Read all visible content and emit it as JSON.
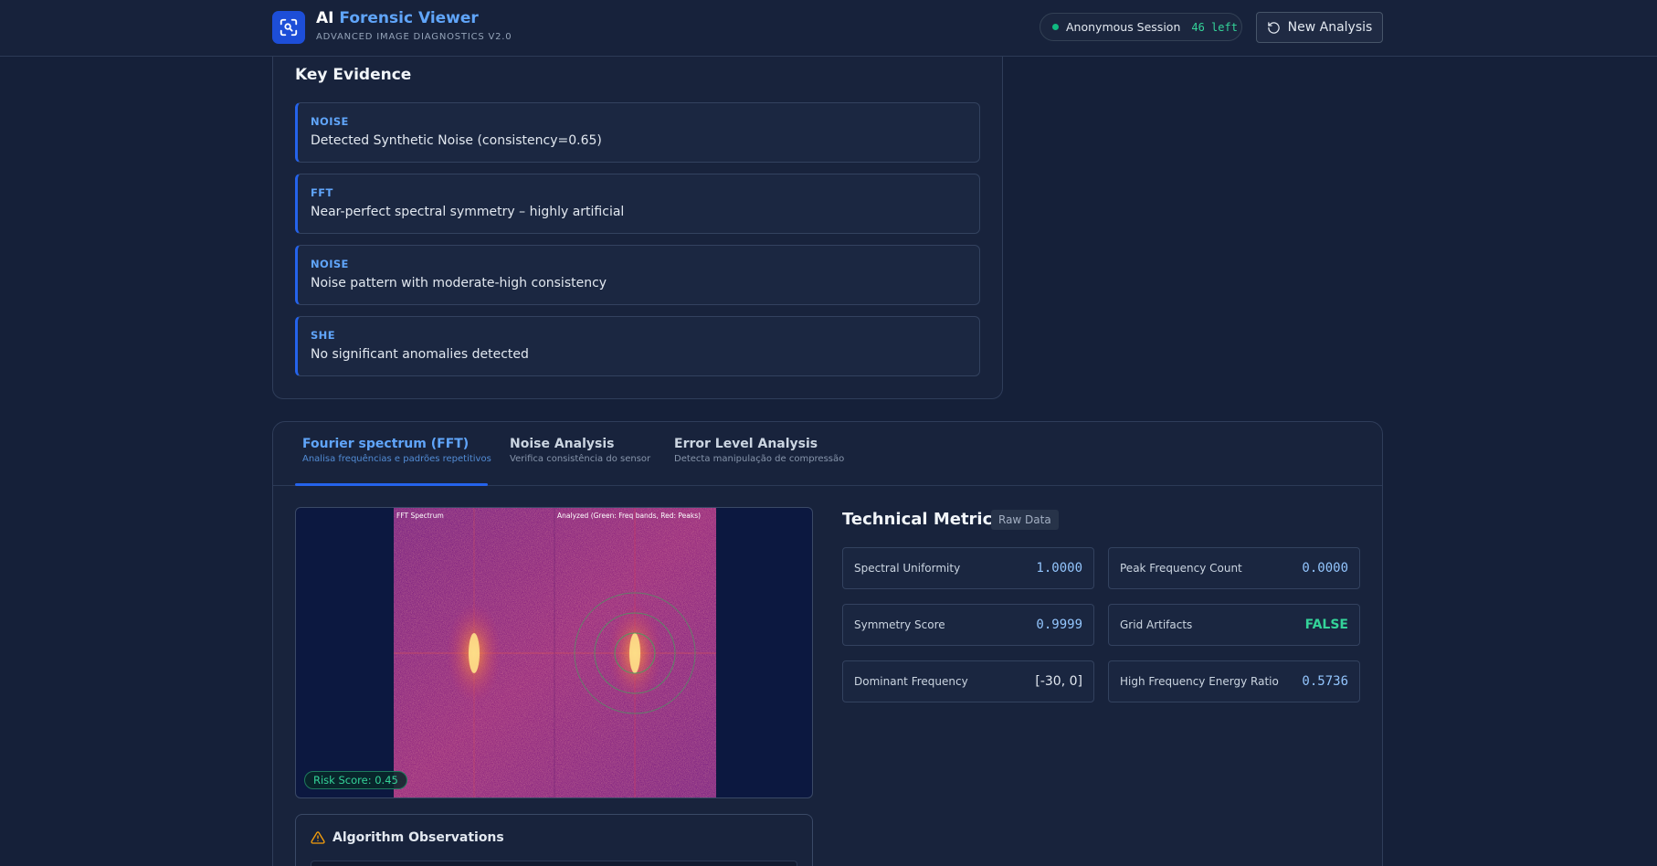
{
  "header": {
    "brand_prefix": "AI",
    "brand_name": "Forensic Viewer",
    "subtitle": "ADVANCED IMAGE DIAGNOSTICS V2.0",
    "session_label": "Anonymous Session",
    "session_left": "46 left",
    "new_analysis_label": "New Analysis",
    "colors": {
      "accent": "#60a5fa",
      "logo_bg": "#1d4ed8",
      "online": "#10b981"
    }
  },
  "evidence": {
    "title": "Key Evidence",
    "items": [
      {
        "tag": "NOISE",
        "text": "Detected Synthetic Noise (consistency=0.65)"
      },
      {
        "tag": "FFT",
        "text": "Near-perfect spectral symmetry – highly artificial"
      },
      {
        "tag": "NOISE",
        "text": "Noise pattern with moderate-high consistency"
      },
      {
        "tag": "SHE",
        "text": "No significant anomalies detected"
      }
    ]
  },
  "tabs": [
    {
      "label": "Fourier spectrum (FFT)",
      "sub": "Analisa frequências e padrões repetitivos",
      "active": true
    },
    {
      "label": "Noise Analysis",
      "sub": "Verifica consistência do sensor",
      "active": false
    },
    {
      "label": "Error Level Analysis",
      "sub": "Detecta manipulação de compressão",
      "active": false
    }
  ],
  "viewer": {
    "left_label": "FFT Spectrum",
    "right_label": "Analyzed (Green: Freq bands, Red: Peaks)",
    "risk_score": "Risk Score: 0.45"
  },
  "observations": {
    "title": "Algorithm Observations",
    "icon": "warning-triangle-icon"
  },
  "metrics": {
    "title": "Technical Metrics",
    "badge": "Raw Data",
    "items": [
      {
        "label": "Spectral Uniformity",
        "value": "1.0000"
      },
      {
        "label": "Peak Frequency Count",
        "value": "0.0000"
      },
      {
        "label": "Symmetry Score",
        "value": "0.9999"
      },
      {
        "label": "Grid Artifacts",
        "value": "FALSE"
      },
      {
        "label": "Dominant Frequency",
        "value": "[-30, 0]"
      },
      {
        "label": "High Frequency Energy Ratio",
        "value": "0.5736"
      }
    ]
  }
}
